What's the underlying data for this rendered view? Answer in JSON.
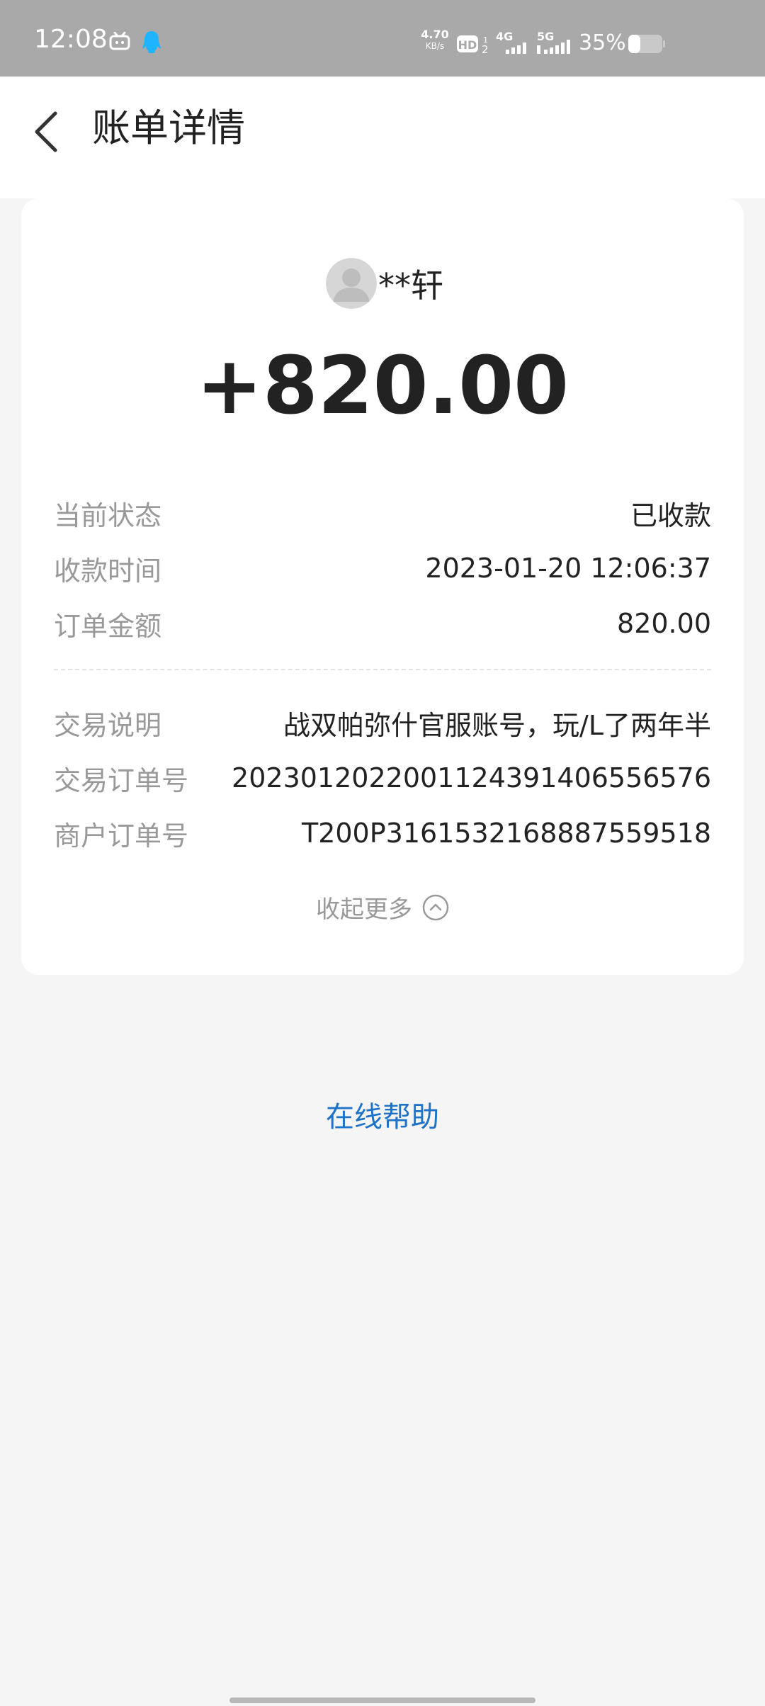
{
  "status_bar": {
    "time": "12:08",
    "net_speed_value": "4.70",
    "net_speed_unit": "KB/s",
    "battery_percent": "35%",
    "icons": [
      "tv-icon",
      "qq-icon",
      "hd-icon",
      "signal-4g-icon",
      "signal-5g-icon",
      "battery-icon"
    ]
  },
  "header": {
    "back_icon": "chevron-left-icon",
    "title": "账单详情"
  },
  "bill": {
    "payer_name": "**轩",
    "amount": "+820.00",
    "rows": [
      {
        "label": "当前状态",
        "value": "已收款"
      },
      {
        "label": "收款时间",
        "value": "2023-01-20 12:06:37"
      },
      {
        "label": "订单金额",
        "value": "820.00"
      },
      {
        "label": "交易说明",
        "value": "战双帕弥什官服账号，玩/L了两年半"
      },
      {
        "label": "交易订单号",
        "value": "2023012022001124391406556576"
      },
      {
        "label": "商户订单号",
        "value": "T200P3161532168887559518"
      }
    ],
    "collapse_label": "收起更多"
  },
  "help_label": "在线帮助",
  "colors": {
    "status_bar_bg": "#a9a9a9",
    "link": "#1e72c8",
    "label_gray": "#999999",
    "page_bg": "#f5f5f5"
  }
}
